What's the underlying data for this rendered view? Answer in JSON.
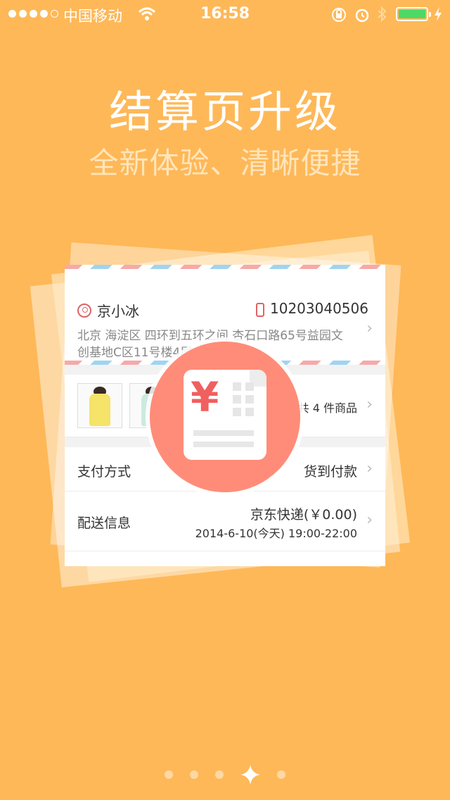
{
  "status_bar": {
    "carrier": "中国移动",
    "time": "16:58",
    "battery_color": "#4CD964"
  },
  "headline": "结算页升级",
  "subline": "全新体验、清晰便捷",
  "card": {
    "receiver_name": "京小冰",
    "phone": "10203040506",
    "address_line1": "北京 海淀区 四环到五环之间 杏石口路65号益园文",
    "address_line2": "创基地C区11号楼4层",
    "goods_count": "共 4 件商品",
    "payment_label": "支付方式",
    "payment_value": "货到付款",
    "delivery_label": "配送信息",
    "delivery_value": "京东快递(￥0.00)",
    "delivery_time": "2014-6-10(今天) 19:00-22:00"
  },
  "badge": {
    "symbol": "¥",
    "color": "#FF8C78"
  },
  "pager": {
    "total": 5,
    "active_index": 3
  },
  "colors": {
    "background": "#FEB858",
    "accent_red": "#E06464"
  }
}
